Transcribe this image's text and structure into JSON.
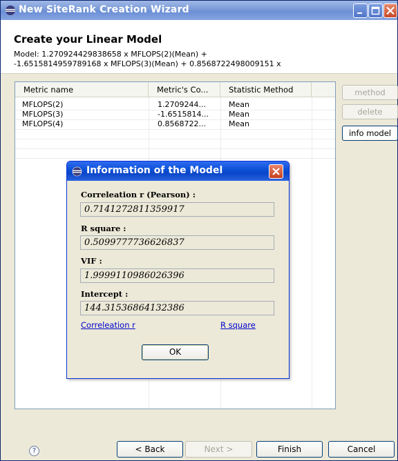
{
  "window": {
    "title": "New SiteRank Creation Wizard"
  },
  "header": {
    "title": "Create your Linear Model",
    "model_line1": "Model: 1.270924429838658 x MFLOPS(2)(Mean) +",
    "model_line2": "-1.6515814959789168 x MFLOPS(3)(Mean) + 0.8568722498009151 x"
  },
  "table": {
    "columns": [
      "Metric name",
      "Metric's Co...",
      "Statistic Method"
    ],
    "rows": [
      {
        "name": "MFLOPS(2)",
        "coef": "1.2709244...",
        "method": "Mean"
      },
      {
        "name": "MFLOPS(3)",
        "coef": "-1.6515814...",
        "method": "Mean"
      },
      {
        "name": "MFLOPS(4)",
        "coef": "0.8568722...",
        "method": "Mean"
      }
    ]
  },
  "side_buttons": {
    "method": "method",
    "delete": "delete",
    "info_model": "info model"
  },
  "footer": {
    "help": "?",
    "back": "< Back",
    "next": "Next >",
    "finish": "Finish",
    "cancel": "Cancel"
  },
  "dialog": {
    "title": "Information of the Model",
    "correlation_label": "Correleation r (Pearson) :",
    "correlation_value": "0.7141272811359917",
    "rsquare_label": "R square :",
    "rsquare_value": "0.5099777736626837",
    "vif_label": "VIF :",
    "vif_value": "1.9999110986026396",
    "intercept_label": "Intercept :",
    "intercept_value": "144.31536864132386",
    "link_correlation": "Correleation r",
    "link_rsquare": "R square",
    "ok": "OK"
  },
  "colors": {
    "titlebar_inactive": "#7a9ad6",
    "dialog_titlebar": "#0a4fd6",
    "link": "#0000cc"
  }
}
